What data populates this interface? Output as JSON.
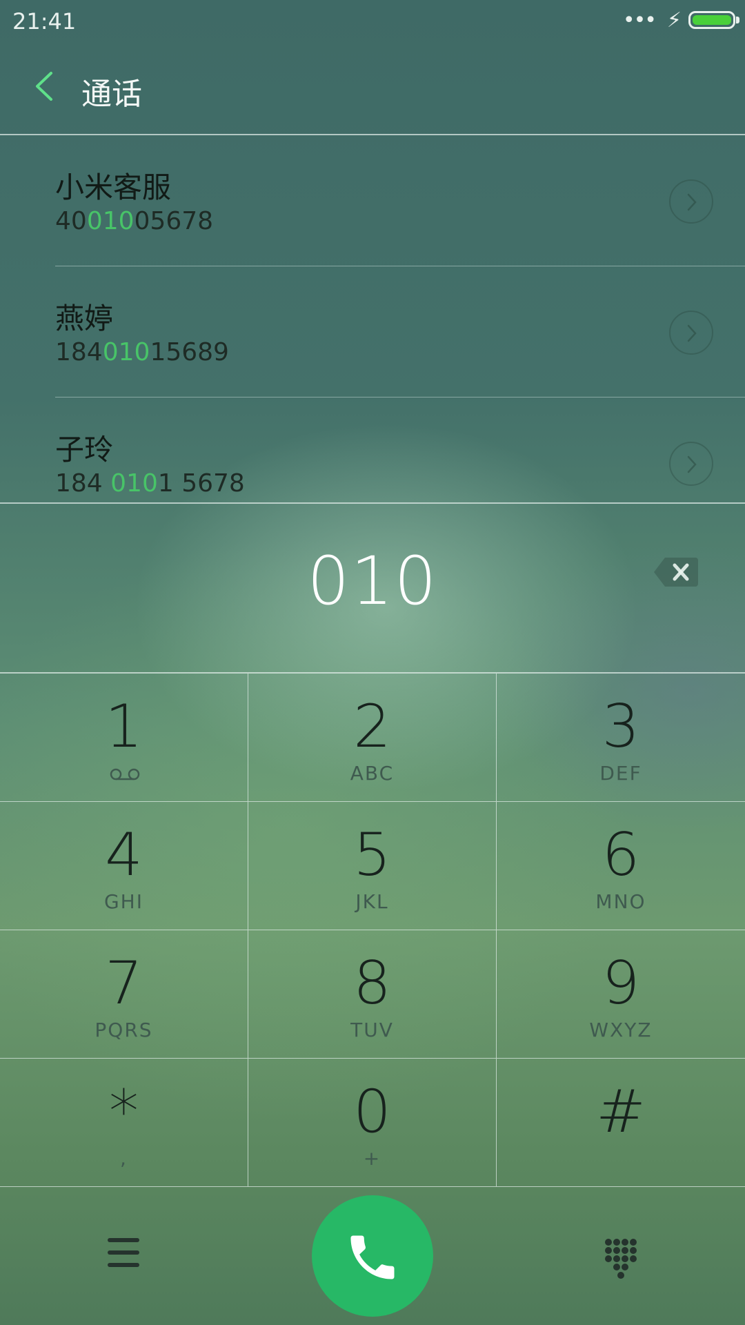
{
  "status": {
    "time": "21:41",
    "signal": "•••",
    "charging": "⚡"
  },
  "header": {
    "title": "通话"
  },
  "contacts": [
    {
      "name": "小米客服",
      "number_pre": "40",
      "number_match": "010",
      "number_post": "05678"
    },
    {
      "name": "燕婷",
      "number_pre": "184",
      "number_match": "010",
      "number_post": "15689"
    },
    {
      "name": "子玲",
      "number_pre": "184 ",
      "number_match": "010",
      "number_post": "1 5678"
    }
  ],
  "dialer": {
    "input": "010"
  },
  "keypad": [
    {
      "digit": "1",
      "letters": ""
    },
    {
      "digit": "2",
      "letters": "ABC"
    },
    {
      "digit": "3",
      "letters": "DEF"
    },
    {
      "digit": "4",
      "letters": "GHI"
    },
    {
      "digit": "5",
      "letters": "JKL"
    },
    {
      "digit": "6",
      "letters": "MNO"
    },
    {
      "digit": "7",
      "letters": "PQRS"
    },
    {
      "digit": "8",
      "letters": "TUV"
    },
    {
      "digit": "9",
      "letters": "WXYZ"
    },
    {
      "digit": "*",
      "letters": ","
    },
    {
      "digit": "0",
      "letters": "+"
    },
    {
      "digit": "#",
      "letters": ""
    }
  ],
  "colors": {
    "accent": "#48c468",
    "call": "#27b866",
    "battery": "#49d03a"
  },
  "icons": {
    "back": "chevron-left-icon",
    "detail": "chevron-right-icon",
    "backspace": "backspace-icon",
    "menu": "menu-icon",
    "call": "phone-icon",
    "dialpad": "dialpad-icon",
    "voicemail": "voicemail-icon"
  }
}
